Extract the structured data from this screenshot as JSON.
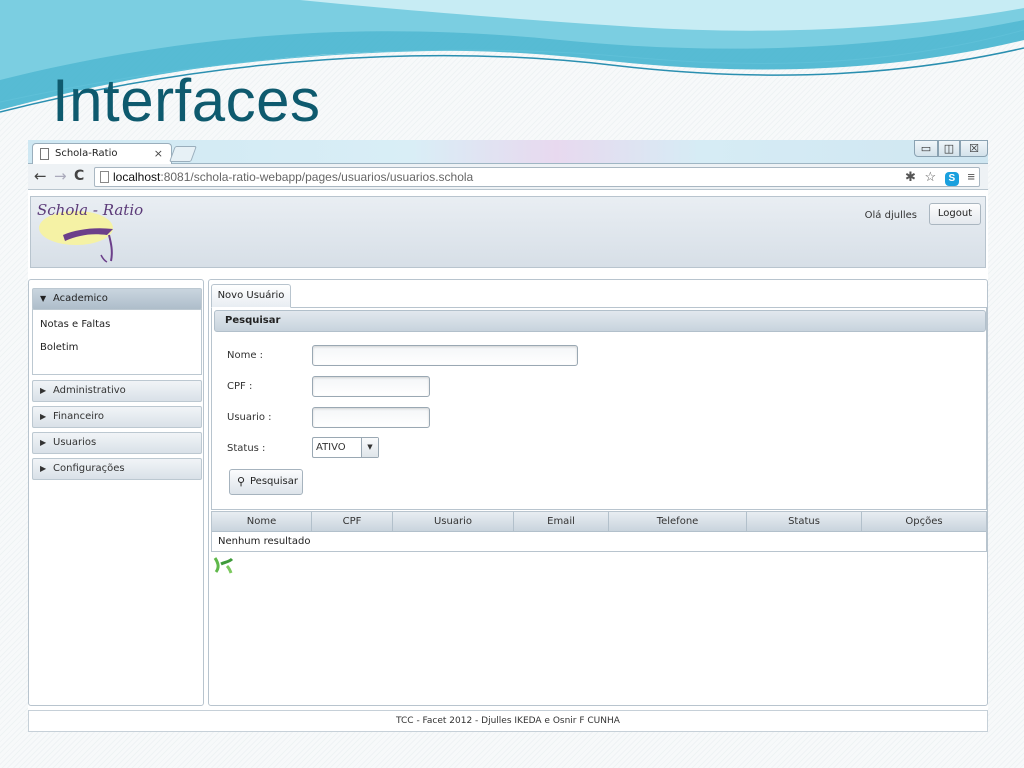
{
  "slide": {
    "title": "Interfaces"
  },
  "browser": {
    "tab_title": "Schola-Ratio",
    "tab_close": "×",
    "url_host": "localhost",
    "url_rest": ":8081/schola-ratio-webapp/pages/usuarios/usuarios.schola",
    "window_controls": {
      "minimize": "▭",
      "maximize": "◫",
      "close": "☒"
    },
    "nav": {
      "back": "←",
      "forward": "→",
      "reload": "C"
    },
    "omni_icons": {
      "extension": "✱",
      "bookmark": "☆",
      "skype": "S",
      "menu": "≡"
    }
  },
  "header": {
    "logo_text": "Schola - Ratio",
    "greeting": "Olá djulles",
    "logout_label": "Logout"
  },
  "sidebar": {
    "sections": [
      {
        "label": "Academico",
        "expanded": true,
        "items": [
          {
            "label": "Notas e Faltas"
          },
          {
            "label": "Boletim"
          }
        ]
      },
      {
        "label": "Administrativo",
        "expanded": false
      },
      {
        "label": "Financeiro",
        "expanded": false
      },
      {
        "label": "Usuarios",
        "expanded": false
      },
      {
        "label": "Configurações",
        "expanded": false
      }
    ]
  },
  "main": {
    "tab_label": "Novo Usuário",
    "fieldset_title": "Pesquisar",
    "form": {
      "nome_label": "Nome :",
      "cpf_label": "CPF :",
      "usuario_label": "Usuario :",
      "status_label": "Status :",
      "nome_value": "",
      "cpf_value": "",
      "usuario_value": "",
      "status_value": "ATIVO"
    },
    "search_button": "Pesquisar",
    "grid": {
      "columns": [
        "Nome",
        "CPF",
        "Usuario",
        "Email",
        "Telefone",
        "Status",
        "Opções"
      ],
      "empty_message": "Nenhum resultado"
    }
  },
  "footer": {
    "text": "TCC - Facet 2012 - Djulles IKEDA e Osnir F CUNHA"
  },
  "colors": {
    "title": "#0e5a6e",
    "header_bg": "#d7dfe7",
    "accent_active": "#aebdca"
  }
}
